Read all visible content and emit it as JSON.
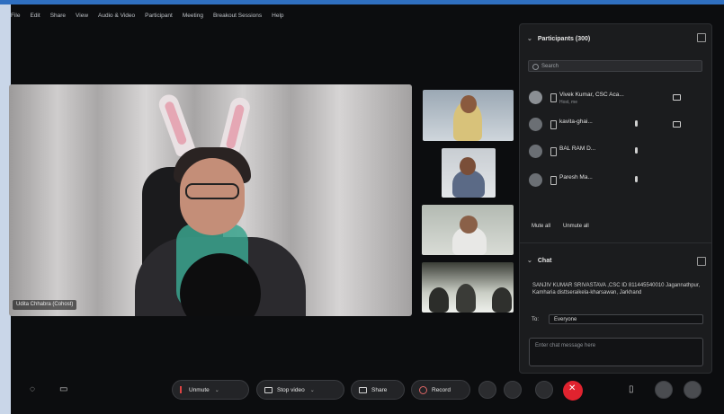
{
  "menu": [
    "File",
    "Edit",
    "Share",
    "View",
    "Audio & Video",
    "Participant",
    "Meeting",
    "Breakout Sessions",
    "Help"
  ],
  "main_video": {
    "name_label": "Udita Chhabra (Cohost)"
  },
  "participants": {
    "title": "Participants (300)",
    "search_placeholder": "Search",
    "rows": [
      {
        "name": "Vivek Kumar, CSC Aca...",
        "sub": "Host, me"
      },
      {
        "name": "kavita-ghai...",
        "sub": ""
      },
      {
        "name": "BAL RAM D...",
        "sub": ""
      },
      {
        "name": "Paresh Ma...",
        "sub": ""
      }
    ],
    "mute_all": "Mute all",
    "unmute_all": "Unmute all"
  },
  "chat": {
    "title": "Chat",
    "message": "SANJIV KUMAR SRIVASTAVA ,CSC ID 811445540010 Jagannathpur, Kamharia disttseraikela-kharsawan, Jarkhand",
    "to_label": "To:",
    "to_value": "Everyone",
    "input_placeholder": "Enter chat message here"
  },
  "toolbar": {
    "unmute": "Unmute",
    "stop_video": "Stop video",
    "share": "Share",
    "record": "Record"
  },
  "colors": {
    "accent": "#2f6fc0",
    "leave": "#e0232f",
    "panel": "#1b1c1e"
  }
}
